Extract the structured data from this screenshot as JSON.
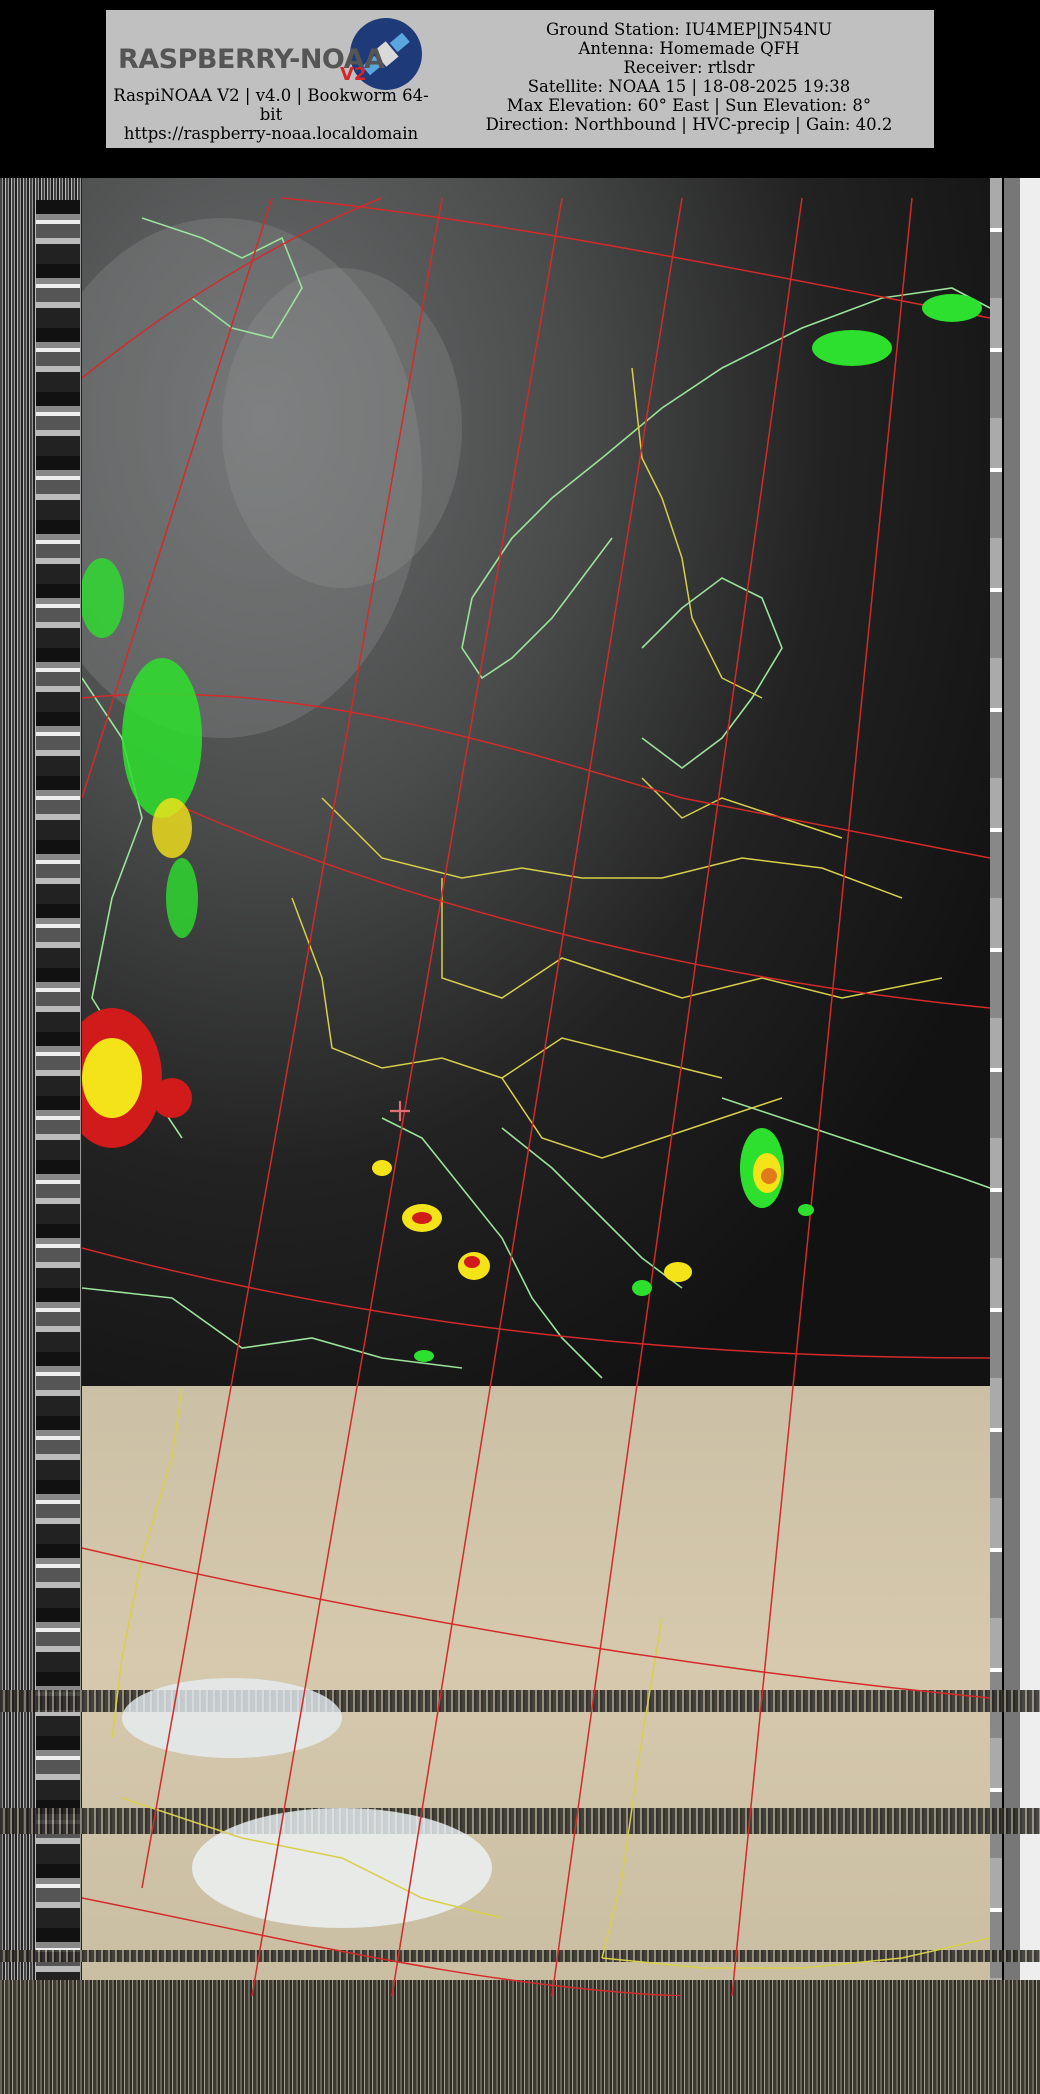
{
  "header": {
    "logo_text": "RASPBERRY-NOAA",
    "logo_version": "V2",
    "left_line1": "RaspiNOAA V2 | v4.0 | Bookworm 64-",
    "left_line2": "bit",
    "left_url": "https://raspberry-noaa.localdomain",
    "ground_station": "Ground Station: IU4MEP|JN54NU",
    "antenna": "Antenna: Homemade QFH",
    "receiver": "Receiver: rtlsdr",
    "satellite": "Satellite: NOAA 15 | 18-08-2025 19:38",
    "elevation": "Max Elevation: 60° East | Sun Elevation: 8°",
    "direction": "Direction: Northbound | HVC-precip | Gain: 40.2"
  },
  "colors": {
    "header_bg": "#c0c0c0",
    "graticule": "#d42a2a",
    "coastline": "#9be29b",
    "borders": "#d8d04a",
    "precip_green": "#2de02d",
    "precip_yellow": "#f5e31a",
    "precip_red": "#d11a1a"
  },
  "icons": {
    "logo": "raspberry-noaa-satellite-logo",
    "marker": "crosshair-plus-icon"
  }
}
